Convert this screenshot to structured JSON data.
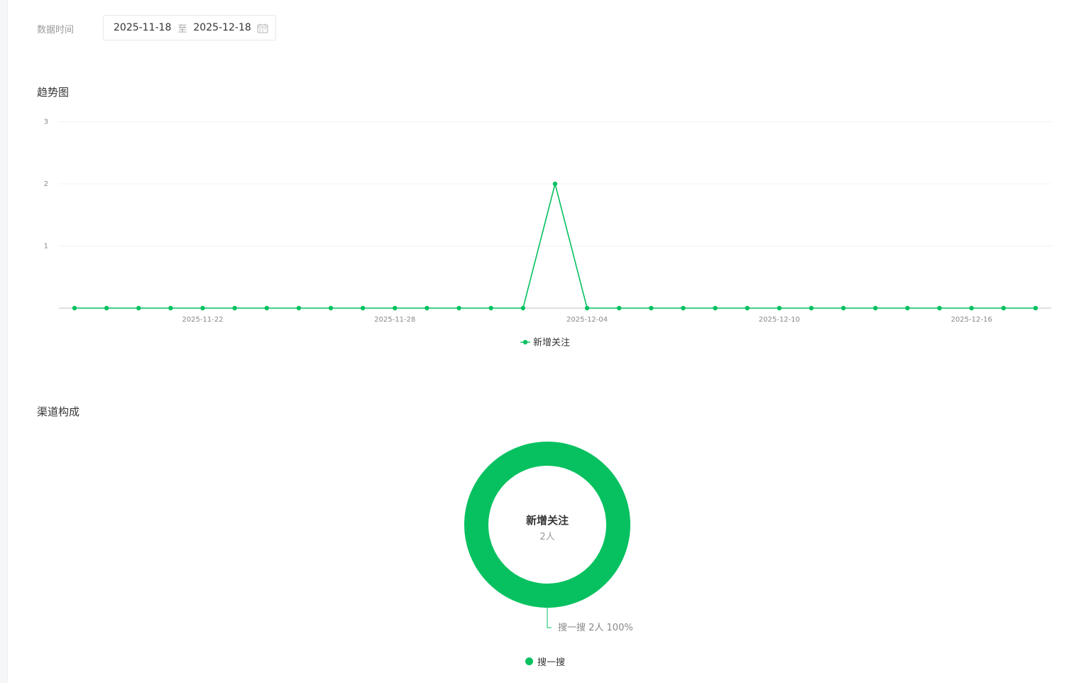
{
  "filter": {
    "label": "数据时间",
    "start_date": "2025-11-18",
    "separator": "至",
    "end_date": "2025-12-18",
    "icon": "calendar-icon"
  },
  "trend": {
    "title": "趋势图"
  },
  "channel": {
    "title": "渠道构成"
  },
  "colors": {
    "accent": "#07c160",
    "grid": "#f0f0f0",
    "axis": "#bfbfbf"
  },
  "chart_data": [
    {
      "type": "line",
      "title": "趋势图",
      "x": [
        "2025-11-18",
        "2025-11-19",
        "2025-11-20",
        "2025-11-21",
        "2025-11-22",
        "2025-11-23",
        "2025-11-24",
        "2025-11-25",
        "2025-11-26",
        "2025-11-27",
        "2025-11-28",
        "2025-11-29",
        "2025-11-30",
        "2025-12-01",
        "2025-12-02",
        "2025-12-03",
        "2025-12-04",
        "2025-12-05",
        "2025-12-06",
        "2025-12-07",
        "2025-12-08",
        "2025-12-09",
        "2025-12-10",
        "2025-12-11",
        "2025-12-12",
        "2025-12-13",
        "2025-12-14",
        "2025-12-15",
        "2025-12-16",
        "2025-12-17",
        "2025-12-18"
      ],
      "x_tick_labels": [
        "2025-11-22",
        "2025-11-28",
        "2025-12-04",
        "2025-12-10",
        "2025-12-16"
      ],
      "y_tick_labels": [
        "1",
        "2",
        "3"
      ],
      "ylim": [
        0,
        3
      ],
      "grid": true,
      "legend": "bottom-center",
      "series": [
        {
          "name": "新增关注",
          "color": "#07c160",
          "values": [
            0,
            0,
            0,
            0,
            0,
            0,
            0,
            0,
            0,
            0,
            0,
            0,
            0,
            0,
            0,
            2,
            0,
            0,
            0,
            0,
            0,
            0,
            0,
            0,
            0,
            0,
            0,
            0,
            0,
            0,
            0
          ]
        }
      ]
    },
    {
      "type": "pie",
      "title": "渠道构成",
      "center_title": "新增关注",
      "center_value": "2人",
      "legend": "bottom-center",
      "slices": [
        {
          "name": "搜一搜",
          "value": 2,
          "label": "搜一搜 2人 100%",
          "color": "#07c160"
        }
      ]
    }
  ]
}
